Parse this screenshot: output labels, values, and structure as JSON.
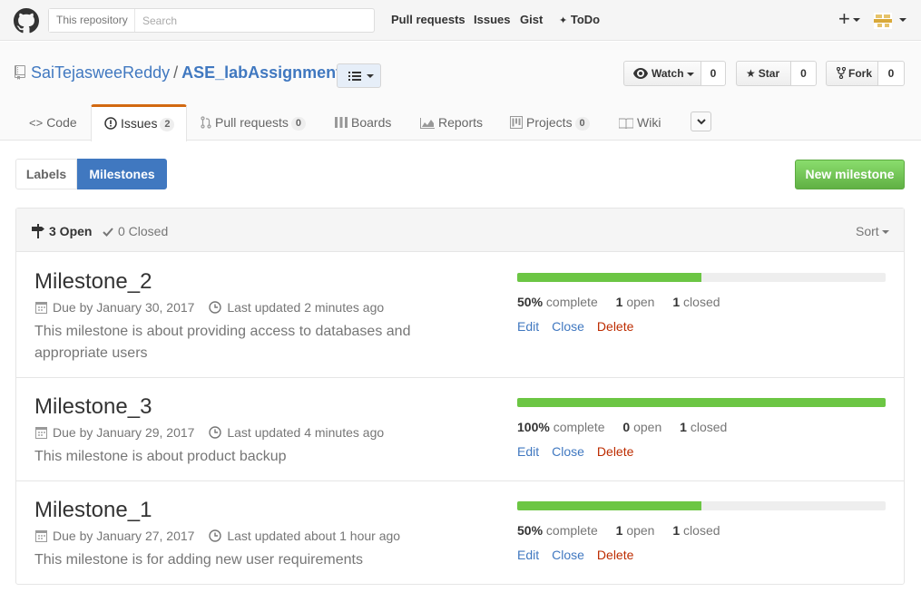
{
  "header": {
    "search_scope": "This repository",
    "search_placeholder": "Search",
    "nav": [
      "Pull requests",
      "Issues",
      "Gist",
      "ToDo"
    ],
    "plus_label": "+"
  },
  "repo": {
    "owner": "SaiTejasweeReddy",
    "separator": "/",
    "name": "ASE_labAssignments",
    "watch_label": "Watch",
    "watch_count": "0",
    "star_label": "Star",
    "star_count": "0",
    "fork_label": "Fork",
    "fork_count": "0"
  },
  "tabs": [
    {
      "label": "Code",
      "icon": "code-icon"
    },
    {
      "label": "Issues",
      "count": "2",
      "icon": "issue-icon",
      "selected": true
    },
    {
      "label": "Pull requests",
      "count": "0",
      "icon": "pull-request-icon"
    },
    {
      "label": "Boards",
      "icon": "boards-icon"
    },
    {
      "label": "Reports",
      "icon": "graph-icon"
    },
    {
      "label": "Projects",
      "count": "0",
      "icon": "project-icon"
    },
    {
      "label": "Wiki",
      "icon": "book-icon"
    }
  ],
  "subnav": {
    "labels": "Labels",
    "milestones": "Milestones",
    "new_milestone": "New milestone"
  },
  "list": {
    "open_label": "3 Open",
    "closed_label": "0 Closed",
    "sort_label": "Sort"
  },
  "milestones": [
    {
      "title": "Milestone_2",
      "due": "Due by January 30, 2017",
      "updated": "Last updated 2 minutes ago",
      "description": "This milestone is about providing access to databases and appropriate users",
      "percent_label": "50%",
      "complete_word": "complete",
      "progress": 0.5,
      "open_count": "1",
      "open_word": "open",
      "closed_count": "1",
      "closed_word": "closed"
    },
    {
      "title": "Milestone_3",
      "due": "Due by January 29, 2017",
      "updated": "Last updated 4 minutes ago",
      "description": "This milestone is about product backup",
      "percent_label": "100%",
      "complete_word": "complete",
      "progress": 1.0,
      "open_count": "0",
      "open_word": "open",
      "closed_count": "1",
      "closed_word": "closed"
    },
    {
      "title": "Milestone_1",
      "due": "Due by January 27, 2017",
      "updated": "Last updated about 1 hour ago",
      "description": "This milestone is for adding new user requirements",
      "percent_label": "50%",
      "complete_word": "complete",
      "progress": 0.5,
      "open_count": "1",
      "open_word": "open",
      "closed_count": "1",
      "closed_word": "closed"
    }
  ],
  "actions": {
    "edit": "Edit",
    "close": "Close",
    "delete": "Delete"
  },
  "colors": {
    "accent": "#4078c0",
    "progress": "#6cc644",
    "new_button": "#60b044",
    "delete": "#bd2c00",
    "tab_highlight": "#d26911"
  }
}
